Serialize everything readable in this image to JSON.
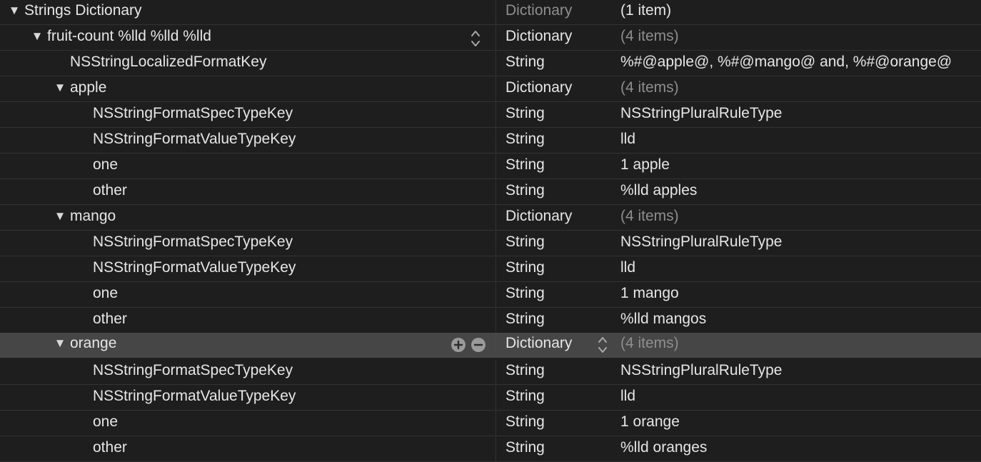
{
  "rows": [
    {
      "key": "Strings Dictionary",
      "type": "Dictionary",
      "value": "(1 item)"
    },
    {
      "key": "fruit-count %lld %lld %lld",
      "type": "Dictionary",
      "value": "(4 items)"
    },
    {
      "key": "NSStringLocalizedFormatKey",
      "type": "String",
      "value": "%#@apple@, %#@mango@ and, %#@orange@"
    },
    {
      "key": "apple",
      "type": "Dictionary",
      "value": "(4 items)"
    },
    {
      "key": "NSStringFormatSpecTypeKey",
      "type": "String",
      "value": "NSStringPluralRuleType"
    },
    {
      "key": "NSStringFormatValueTypeKey",
      "type": "String",
      "value": "lld"
    },
    {
      "key": "one",
      "type": "String",
      "value": "1 apple"
    },
    {
      "key": "other",
      "type": "String",
      "value": "%lld apples"
    },
    {
      "key": "mango",
      "type": "Dictionary",
      "value": "(4 items)"
    },
    {
      "key": "NSStringFormatSpecTypeKey",
      "type": "String",
      "value": "NSStringPluralRuleType"
    },
    {
      "key": "NSStringFormatValueTypeKey",
      "type": "String",
      "value": "lld"
    },
    {
      "key": "one",
      "type": "String",
      "value": "1 mango"
    },
    {
      "key": "other",
      "type": "String",
      "value": "%lld mangos"
    },
    {
      "key": "orange",
      "type": "Dictionary",
      "value": "(4 items)"
    },
    {
      "key": "NSStringFormatSpecTypeKey",
      "type": "String",
      "value": "NSStringPluralRuleType"
    },
    {
      "key": "NSStringFormatValueTypeKey",
      "type": "String",
      "value": "lld"
    },
    {
      "key": "one",
      "type": "String",
      "value": "1 orange"
    },
    {
      "key": "other",
      "type": "String",
      "value": "%lld oranges"
    }
  ],
  "selected_row_key": "orange",
  "icons": {
    "disclosure": "disclosure-triangle-expanded-icon",
    "stepper": "up-down-chevron-icon",
    "add": "add-circle-icon",
    "remove": "remove-circle-icon"
  },
  "colors": {
    "background": "#1e1e1e",
    "row_divider": "#333333",
    "selected_row": "#464646",
    "text": "#e6e6e6",
    "dim_text": "#8e8e8e"
  }
}
